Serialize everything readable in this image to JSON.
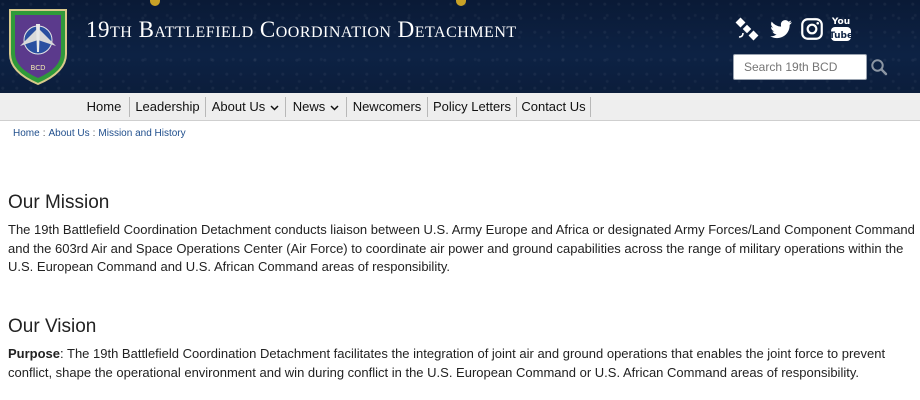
{
  "header": {
    "title": "19th Battlefield Coordination Detachment",
    "logo_text": "BCD",
    "social": [
      "satellite-icon",
      "twitter-icon",
      "instagram-icon",
      "youtube-icon"
    ],
    "search_placeholder": "Search 19th BCD"
  },
  "nav": {
    "items": [
      {
        "label": "Home"
      },
      {
        "label": "Leadership"
      },
      {
        "label": "About Us",
        "dropdown": true
      },
      {
        "label": "News",
        "dropdown": true
      },
      {
        "label": "Newcomers"
      },
      {
        "label": "Policy Letters"
      },
      {
        "label": "Contact Us"
      }
    ]
  },
  "breadcrumb": {
    "items": [
      "Home",
      "About Us",
      "Mission and History"
    ],
    "separator": ":"
  },
  "mission": {
    "heading": "Our Mission",
    "text": "The 19th Battlefield Coordination Detachment conducts liaison between U.S. Army Europe and Africa or designated Army Forces/Land Component Command and the 603rd Air and Space Operations Center (Air Force) to coordinate air power and ground capabilities across the range of military operations within the U.S. European Command and U.S. African Command areas of responsibility."
  },
  "vision": {
    "heading": "Our Vision",
    "purpose_label": "Purpose",
    "purpose_text": ": The 19th Battlefield Coordination Detachment facilitates the integration of joint air and ground operations that enables the joint force to prevent conflict, shape the operational environment and win during conflict in the U.S. European Command or U.S. African Command areas of responsibility."
  },
  "colors": {
    "header_bg": "#0d2244",
    "nav_bg": "#eeeeee",
    "link": "#1f4e8c",
    "logo_green": "#2f9a3a",
    "logo_purple": "#5b3a8c"
  }
}
